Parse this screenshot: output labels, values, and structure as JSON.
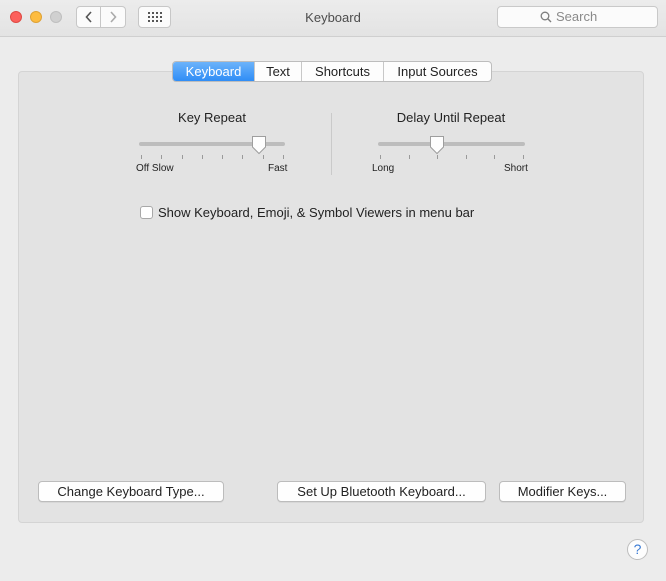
{
  "window": {
    "title": "Keyboard"
  },
  "toolbar": {
    "search_placeholder": "Search",
    "icons": {
      "back": "chevron-left-icon",
      "forward": "chevron-right-icon",
      "show_all": "grid-icon",
      "search": "magnifier-icon"
    }
  },
  "tabs": [
    {
      "label": "Keyboard",
      "selected": true
    },
    {
      "label": "Text",
      "selected": false
    },
    {
      "label": "Shortcuts",
      "selected": false
    },
    {
      "label": "Input Sources",
      "selected": false
    }
  ],
  "key_repeat": {
    "title": "Key Repeat",
    "left_label": "Off Slow",
    "right_label": "Fast",
    "tick_count": 8,
    "value_fraction": 0.83
  },
  "delay_until_repeat": {
    "title": "Delay Until Repeat",
    "left_label": "Long",
    "right_label": "Short",
    "tick_count": 6,
    "value_fraction": 0.4
  },
  "show_viewers": {
    "label": "Show Keyboard, Emoji, & Symbol Viewers in menu bar",
    "checked": false
  },
  "buttons": {
    "change_type": "Change Keyboard Type...",
    "bluetooth": "Set Up Bluetooth Keyboard...",
    "modifier": "Modifier Keys..."
  },
  "help": {
    "label": "?"
  },
  "colors": {
    "accent": "#2f8df6",
    "close": "#fc605c",
    "minimize": "#fdbc40",
    "zoom_disabled": "#d0d0d0"
  }
}
